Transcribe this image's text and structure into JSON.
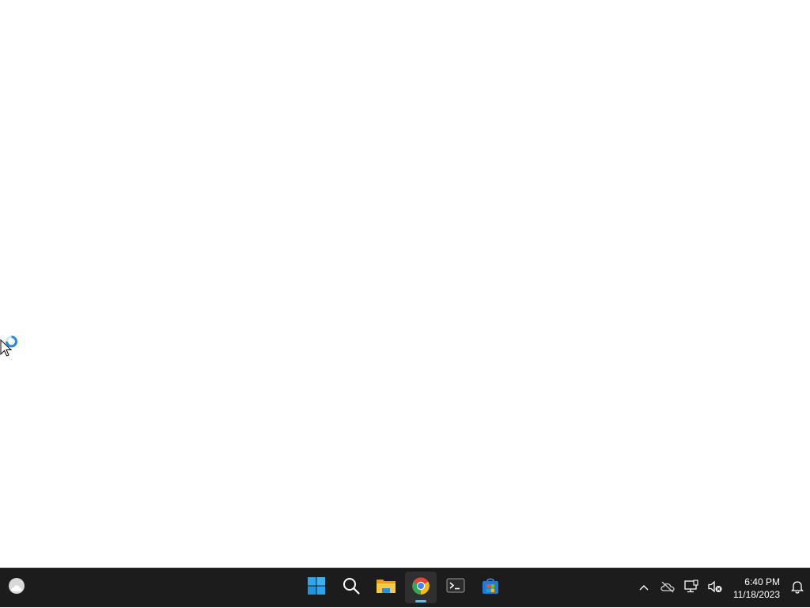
{
  "taskbar": {
    "widgets": {
      "icon": "weather-cloud-icon"
    },
    "apps": [
      {
        "icon": "windows-start-icon",
        "active": false
      },
      {
        "icon": "search-icon",
        "active": false
      },
      {
        "icon": "file-explorer-icon",
        "active": false
      },
      {
        "icon": "chrome-icon",
        "active": true
      },
      {
        "icon": "terminal-icon",
        "active": false
      },
      {
        "icon": "microsoft-store-icon",
        "active": false
      }
    ],
    "tray": {
      "icons": [
        "chevron-up-icon",
        "onedrive-offline-icon",
        "network-icon",
        "volume-muted-icon",
        "bell-icon"
      ],
      "time": "6:40 PM",
      "date": "11/18/2023"
    },
    "accent_color": "#4cc2ff"
  }
}
